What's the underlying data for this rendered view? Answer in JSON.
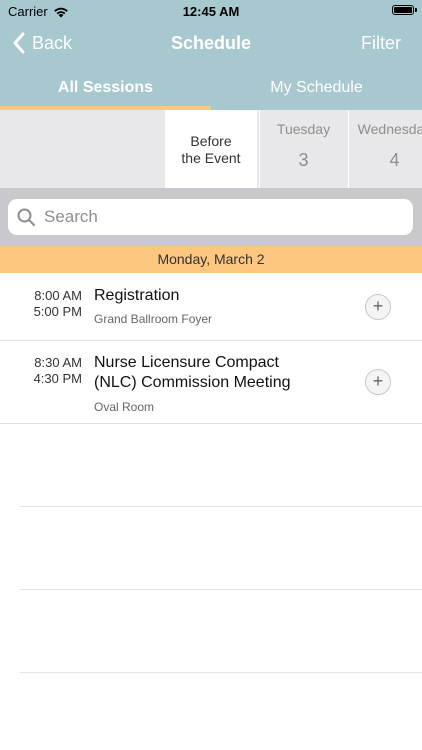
{
  "status_bar": {
    "carrier": "Carrier",
    "time": "12:45 AM"
  },
  "nav": {
    "back_label": "Back",
    "title": "Schedule",
    "filter_label": "Filter"
  },
  "tabs": [
    {
      "label": "All Sessions",
      "active": true
    },
    {
      "label": "My Schedule",
      "active": false
    }
  ],
  "date_strip": {
    "before_event_line1": "Before",
    "before_event_line2": "the Event",
    "days": [
      {
        "weekday": "Tuesday",
        "number": "3"
      },
      {
        "weekday": "Wednesday",
        "number": "4"
      }
    ]
  },
  "search": {
    "placeholder": "Search"
  },
  "day_header": "Monday, March 2",
  "sessions": [
    {
      "start_time": "8:00 AM",
      "end_time": "5:00 PM",
      "title_line1": "Registration",
      "title_line2": "",
      "location": "Grand Ballroom Foyer",
      "add_label": "+"
    },
    {
      "start_time": "8:30 AM",
      "end_time": "4:30 PM",
      "title_line1": "Nurse Licensure Compact",
      "title_line2": "(NLC) Commission Meeting",
      "location": "Oval Room",
      "add_label": "+"
    }
  ],
  "colors": {
    "header_bg": "#a8c8cf",
    "tab_indicator": "#fdc77f",
    "day_header_bg": "#fdc77f",
    "search_area_bg": "#c9c8cd",
    "date_strip_bg": "#e8e8ea"
  }
}
